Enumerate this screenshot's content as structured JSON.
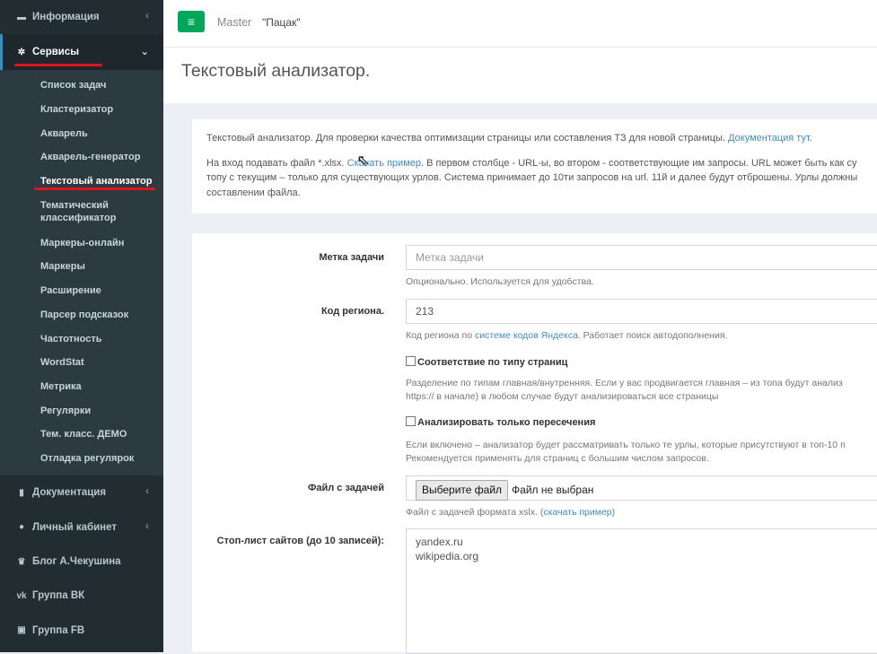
{
  "sidebar": {
    "info_label": "Информация",
    "services_label": "Сервисы",
    "items": [
      "Список задач",
      "Кластеризатор",
      "Акварель",
      "Акварель-генератор",
      "Текстовый анализатор",
      "Тематический классификатор",
      "Маркеры-онлайн",
      "Маркеры",
      "Расширение",
      "Парсер подсказок",
      "Частотность",
      "WordStat",
      "Метрика",
      "Регулярки",
      "Тем. класс. ДЕМО",
      "Отладка регулярок"
    ],
    "docs_label": "Документация",
    "cabinet_label": "Личный кабинет",
    "blog_label": "Блог А.Чекушина",
    "vk_label": "Группа ВК",
    "fb_label": "Группа FB",
    "chevron_left": "‹",
    "chevron_down": "⌄"
  },
  "header": {
    "menu_icon": "≡",
    "brand": "Master",
    "project": "\"Пацак\""
  },
  "page": {
    "title": "Текстовый анализатор."
  },
  "info": {
    "line1_text": "Текстовый анализатор. Для проверки качества оптимизации страницы или составления ТЗ для новой страницы. ",
    "line1_link": "Документация тут",
    "line1_end": ".",
    "line2_pre": "На вход подавать файл *.xlsx. ",
    "line2_link": "Скачать пример",
    "line2_post": ". В первом столбце - URL-ы, во втором - соответствующие им запросы. URL может быть как су",
    "line3": "топу с текущим – только для существующих урлов. Система принимает до 10ти запросов на url. 11й и далее будут отброшены. Урлы должны",
    "line4": "составлении файла."
  },
  "form": {
    "task_label": "Метка задачи",
    "task_placeholder": "Метка задачи",
    "task_help": "Опционально. Используется для удобства.",
    "region_label": "Код региона.",
    "region_value": "213",
    "region_help_pre": "Код региона по ",
    "region_help_link": "системе кодов Яндекса",
    "region_help_post": ". Работает поиск автодополнения.",
    "pagetype_label": "Соответствие по типу страниц",
    "pagetype_help1": "Разделение по типам главная/внутренняя. Если у вас продвигается главная – из топа будут анализ",
    "pagetype_help2": "https:// в начале) в любом случае будут анализироваться все страницы",
    "intersect_label": "Анализировать только пересечения",
    "intersect_help1": "Если включено – анализатор будет рассматривать только те урлы, которые присутствуют в топ-10 п",
    "intersect_help2": "Рекомендуется применять для страниц с большим числом запросов.",
    "file_label": "Файл с задачей",
    "file_button": "Выберите файл",
    "file_status": "Файл не выбран",
    "file_help_pre": "Файл с задачей формата xslx. (",
    "file_help_link": "скачать пример",
    "file_help_post": ")",
    "stoplist_label": "Стоп-лист сайтов (до 10 записей):",
    "stoplist_lines": [
      "yandex.ru",
      "wikipedia.org"
    ]
  },
  "colors": {
    "sidebar_bg": "#222d32",
    "accent_green": "#00a65a",
    "link_blue": "#3c8dbc",
    "annotation_red": "#e0141a"
  }
}
